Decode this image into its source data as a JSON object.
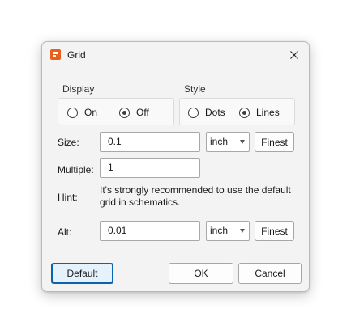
{
  "window": {
    "title": "Grid",
    "icon": "app-logo-icon",
    "close_icon": "close-icon"
  },
  "display": {
    "label": "Display",
    "options": [
      {
        "label": "On",
        "checked": false
      },
      {
        "label": "Off",
        "checked": true
      }
    ]
  },
  "style": {
    "label": "Style",
    "options": [
      {
        "label": "Dots",
        "checked": false
      },
      {
        "label": "Lines",
        "checked": true
      }
    ]
  },
  "size": {
    "label": "Size:",
    "value": "0.1",
    "unit": "inch",
    "finest_label": "Finest"
  },
  "multiple": {
    "label": "Multiple:",
    "value": "1"
  },
  "hint": {
    "label": "Hint:",
    "line1": "It's strongly recommended to use the default",
    "line2": "grid in schematics."
  },
  "alt": {
    "label": "Alt:",
    "value": "0.01",
    "unit": "inch",
    "finest_label": "Finest"
  },
  "buttons": {
    "default": "Default",
    "ok": "OK",
    "cancel": "Cancel"
  },
  "colors": {
    "accent": "#0a64ad",
    "app_icon": "#e8601c"
  }
}
